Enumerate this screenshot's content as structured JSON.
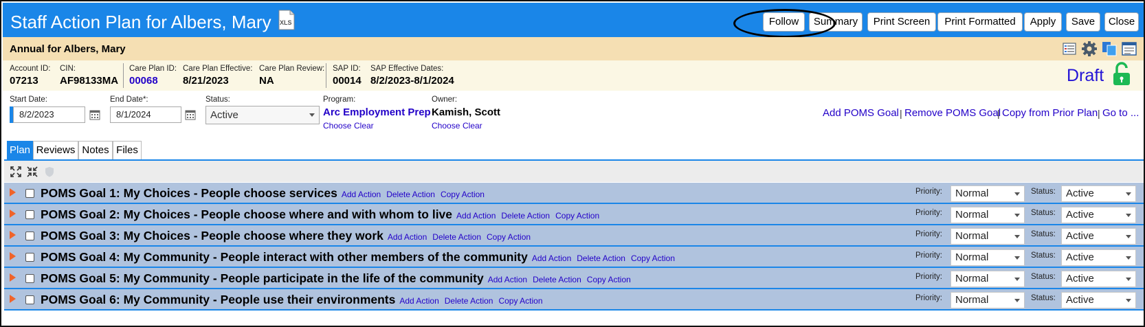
{
  "header": {
    "title": "Staff Action Plan for Albers, Mary",
    "xls_icon_text": "XLS",
    "buttons": [
      "Follow",
      "Summary",
      "Print Screen",
      "Print Formatted",
      "Apply",
      "Save",
      "Close"
    ]
  },
  "subheader": {
    "title": "Annual for Albers, Mary",
    "icons": [
      "list-view-icon",
      "gear-icon",
      "copy-docs-icon",
      "report-icon"
    ]
  },
  "info": {
    "account_id": {
      "label": "Account ID:",
      "value": "07213"
    },
    "cin": {
      "label": "CIN:",
      "value": "AF98133MA"
    },
    "care_plan_id": {
      "label": "Care Plan ID:",
      "value": "00068"
    },
    "care_plan_effective": {
      "label": "Care Plan Effective:",
      "value": "8/21/2023"
    },
    "care_plan_review": {
      "label": "Care Plan Review:",
      "value": "NA"
    },
    "sap_id": {
      "label": "SAP ID:",
      "value": "00014"
    },
    "sap_effective": {
      "label": "SAP Effective Dates:",
      "value": "8/2/2023-8/1/2024"
    },
    "state": "Draft"
  },
  "dates": {
    "start_label": "Start Date:",
    "start_value": "8/2/2023",
    "end_label": "End Date*:",
    "end_value": "8/1/2024",
    "status_label": "Status:",
    "status_value": "Active",
    "program_label": "Program:",
    "program_value": "Arc Employment Prep",
    "owner_label": "Owner:",
    "owner_value": "Kamish, Scott",
    "choose": "Choose",
    "clear": "Clear",
    "right_links": [
      "Add POMS Goal",
      "Remove POMS Goal",
      "Copy from Prior Plan",
      "Go to ..."
    ],
    "pipe": "|"
  },
  "tabs": [
    "Plan",
    "Reviews",
    "Notes",
    "Files"
  ],
  "toolbar_icons": [
    "expand-all-icon",
    "collapse-all-icon",
    "shield-icon"
  ],
  "goal_actions": [
    "Add Action",
    "Delete Action",
    "Copy Action"
  ],
  "goal_labels": {
    "priority": "Priority:",
    "status": "Status:"
  },
  "goals": [
    {
      "prefix": "POMS Goal 1",
      "name": "My Choices - People choose services",
      "priority": "Normal",
      "status": "Active"
    },
    {
      "prefix": "POMS Goal 2",
      "name": "My Choices - People choose where and with whom to live",
      "priority": "Normal",
      "status": "Active"
    },
    {
      "prefix": "POMS Goal 3",
      "name": "My Choices - People choose where they work",
      "priority": "Normal",
      "status": "Active"
    },
    {
      "prefix": "POMS Goal 4",
      "name": "My Community - People interact with other members of the community",
      "priority": "Normal",
      "status": "Active"
    },
    {
      "prefix": "POMS Goal 5",
      "name": "My Community - People participate in the life of the community",
      "priority": "Normal",
      "status": "Active"
    },
    {
      "prefix": "POMS Goal 6",
      "name": "My Community - People use their environments",
      "priority": "Normal",
      "status": "Active"
    }
  ],
  "colors": {
    "header_blue": "#1a86e8",
    "link": "#2200c8",
    "goal_row": "#b0c3de",
    "subheader": "#f5dfb3"
  }
}
